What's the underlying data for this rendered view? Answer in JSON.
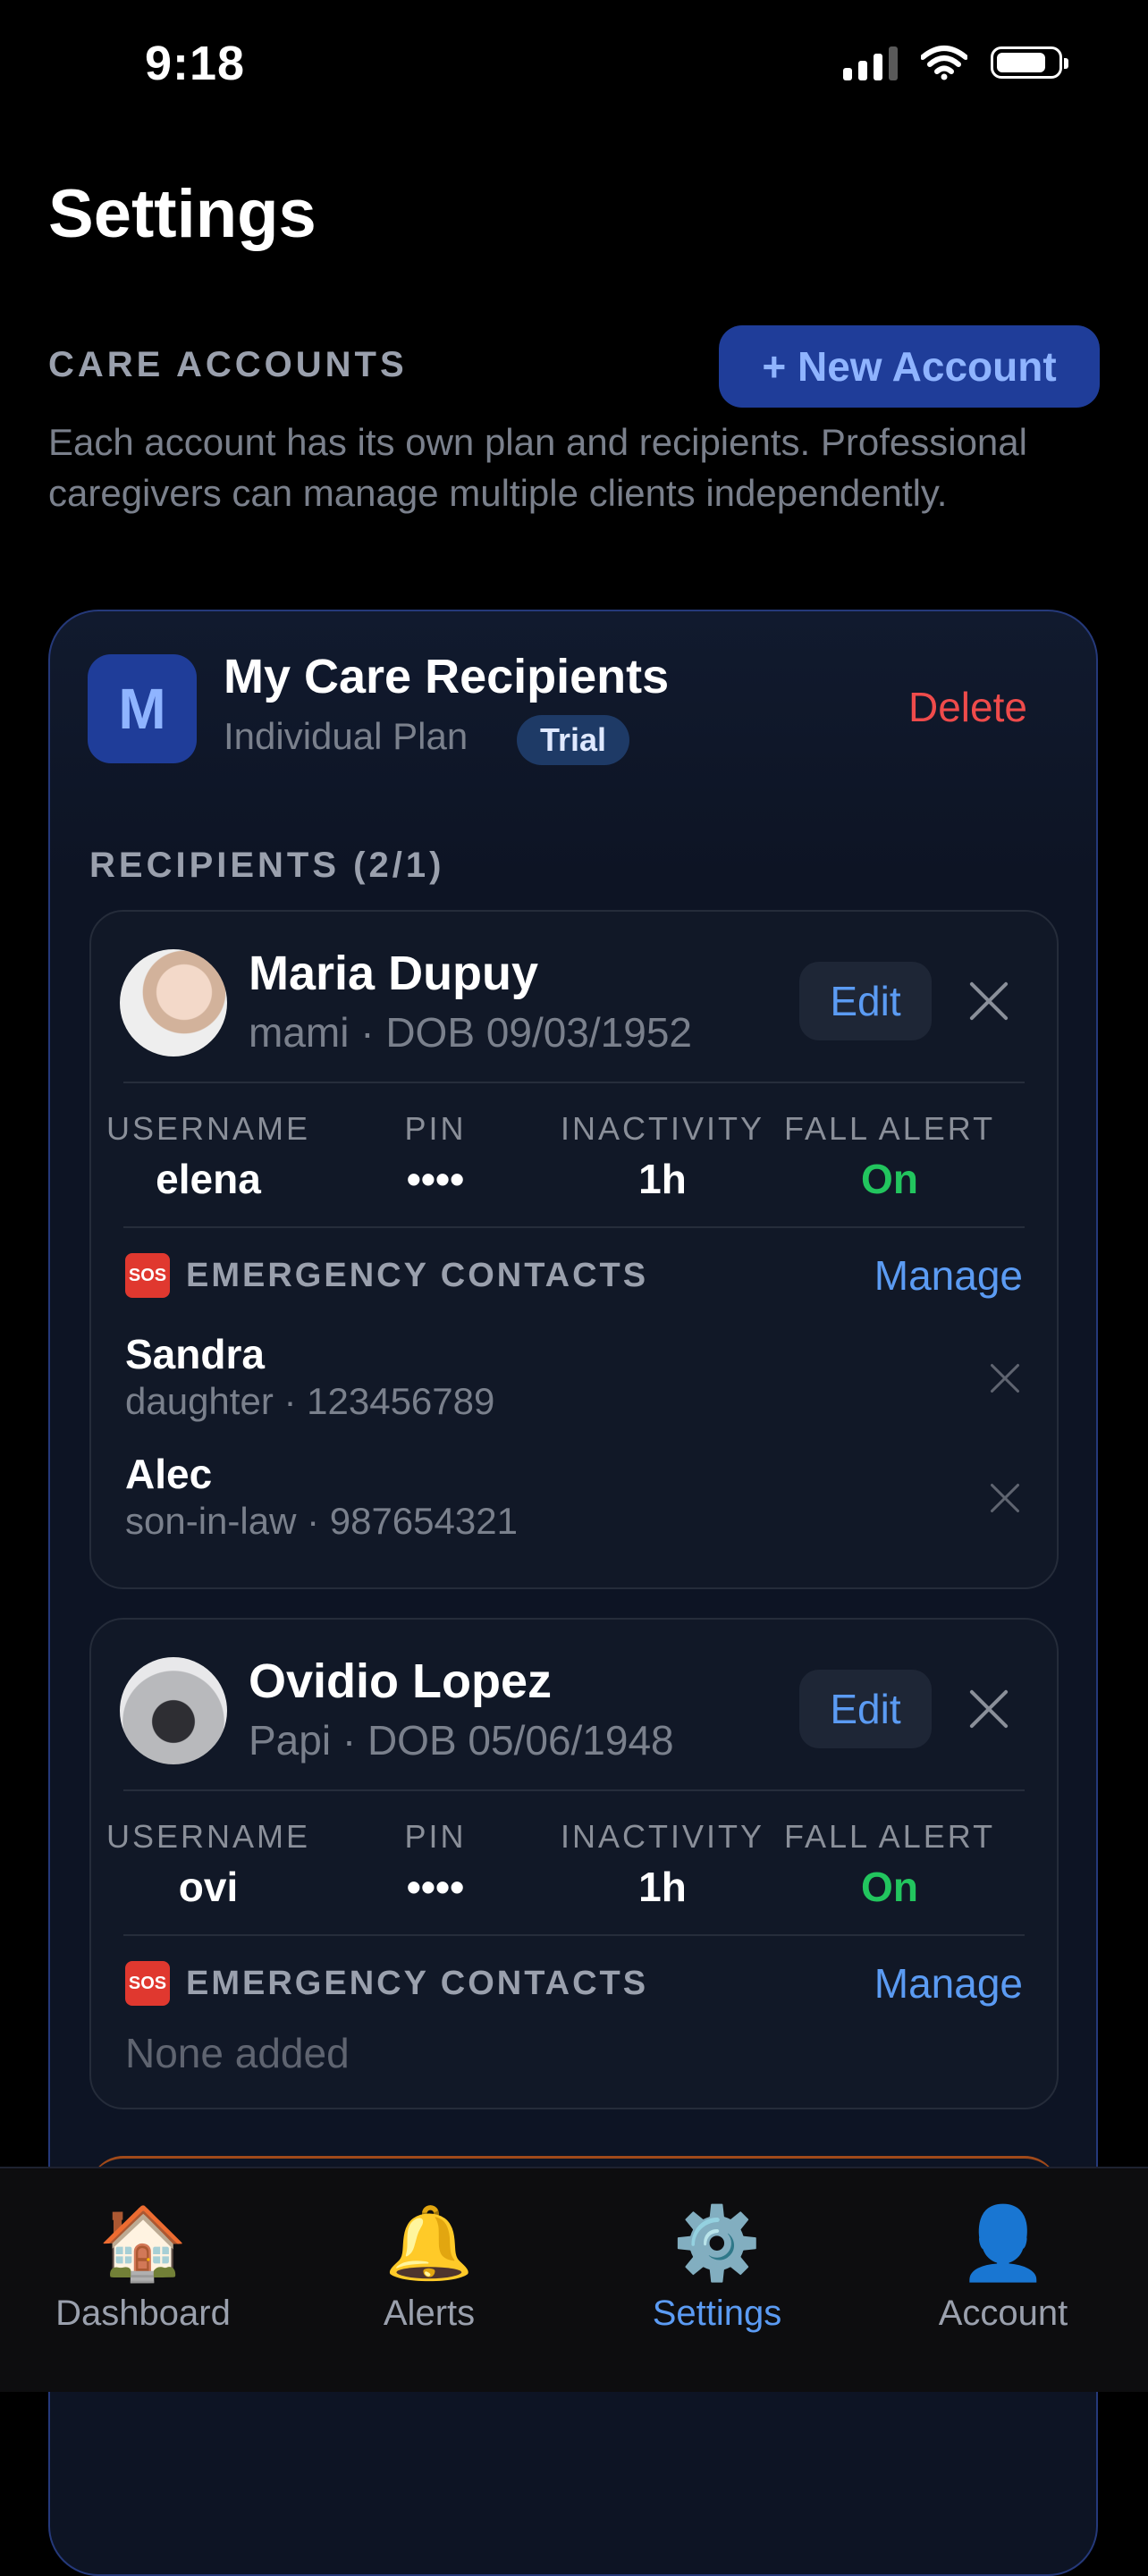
{
  "status_bar": {
    "time": "9:18",
    "signal_bars": 3,
    "battery_level": 0.85
  },
  "page": {
    "title": "Settings"
  },
  "care_accounts": {
    "section_label": "CARE ACCOUNTS",
    "new_account_label": "+ New Account",
    "description": "Each account has its own plan and recipients. Professional caregivers can manage multiple clients independently."
  },
  "account": {
    "initial": "M",
    "name": "My Care Recipients",
    "plan": "Individual Plan",
    "badge": "Trial",
    "delete_label": "Delete",
    "recipients_label": "RECIPIENTS (2/1)"
  },
  "recipients": [
    {
      "name": "Maria Dupuy",
      "subtitle": "mami · DOB 09/03/1952",
      "edit_label": "Edit",
      "stats": [
        {
          "label": "USERNAME",
          "value": "elena"
        },
        {
          "label": "PIN",
          "value": "••••"
        },
        {
          "label": "INACTIVITY",
          "value": "1h"
        },
        {
          "label": "FALL ALERT",
          "value": "On"
        }
      ],
      "emergency_label": "EMERGENCY CONTACTS",
      "sos": "SOS",
      "manage_label": "Manage",
      "contacts": [
        {
          "name": "Sandra",
          "detail": "daughter · 123456789"
        },
        {
          "name": "Alec",
          "detail": "son-in-law · 987654321"
        }
      ]
    },
    {
      "name": "Ovidio Lopez",
      "subtitle": "Papi · DOB 05/06/1948",
      "edit_label": "Edit",
      "stats": [
        {
          "label": "USERNAME",
          "value": "ovi"
        },
        {
          "label": "PIN",
          "value": "••••"
        },
        {
          "label": "INACTIVITY",
          "value": "1h"
        },
        {
          "label": "FALL ALERT",
          "value": "On"
        }
      ],
      "emergency_label": "EMERGENCY CONTACTS",
      "sos": "SOS",
      "manage_label": "Manage",
      "none_label": "None added"
    }
  ],
  "tabs": [
    {
      "label": "Dashboard",
      "icon": "🏠",
      "icon_name": "house-icon"
    },
    {
      "label": "Alerts",
      "icon": "🔔",
      "icon_name": "bell-icon"
    },
    {
      "label": "Settings",
      "icon": "⚙️",
      "icon_name": "gear-icon",
      "active": true
    },
    {
      "label": "Account",
      "icon": "👤",
      "icon_name": "person-icon"
    }
  ],
  "colors": {
    "accent": "#5b9bf3",
    "danger": "#ef4b4b",
    "success": "#22c55e",
    "brand": "#1f3d99"
  }
}
